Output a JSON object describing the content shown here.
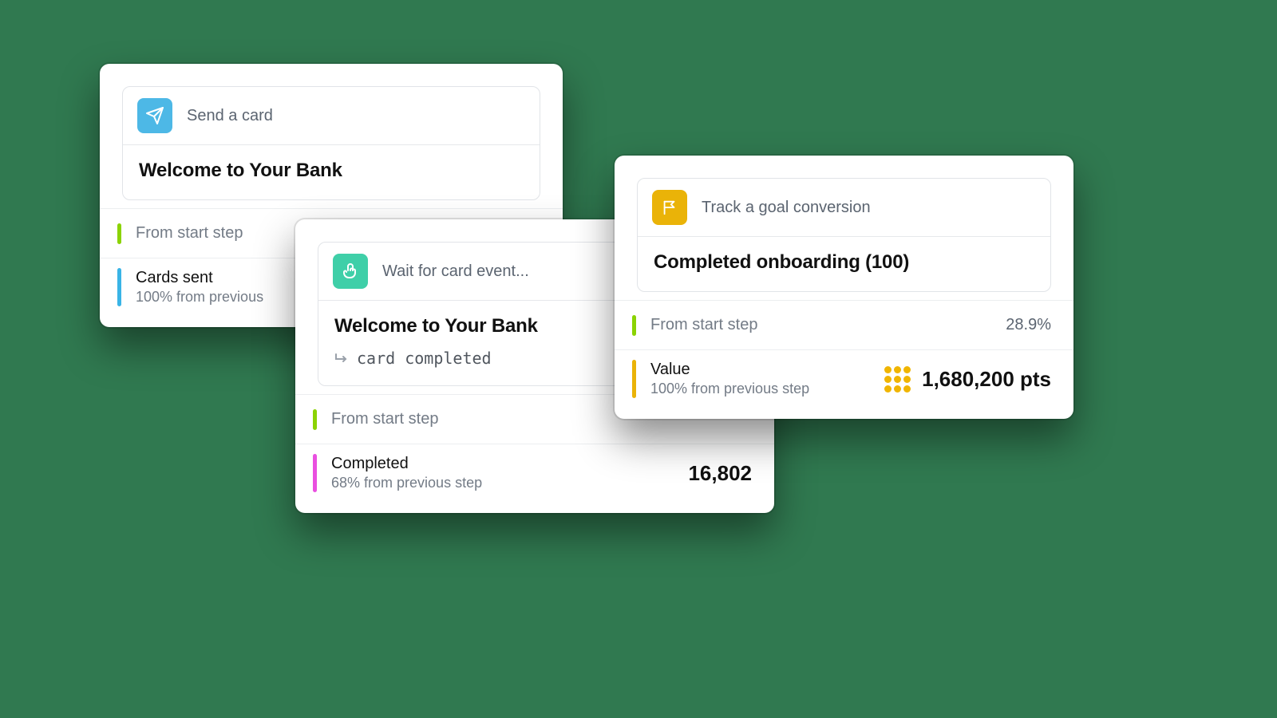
{
  "colors": {
    "background": "#307950",
    "icon_send": "#4db8e6",
    "icon_wait": "#3fcfa8",
    "icon_flag": "#eab308",
    "bar_green": "#8bd303",
    "bar_blue": "#39b4e6",
    "bar_pink": "#e94fe0",
    "bar_amber": "#eab308",
    "coin": "#f0b500"
  },
  "card1": {
    "header_label": "Send a card",
    "title": "Welcome to Your Bank",
    "stat1_label": "From start step",
    "stat2_label": "Cards sent",
    "stat2_sub": "100% from previous"
  },
  "card2": {
    "header_label": "Wait for card event...",
    "title": "Welcome to Your Bank",
    "subline": "card completed",
    "stat1_label": "From start step",
    "stat2_label": "Completed",
    "stat2_sub": "68% from previous step",
    "stat2_value": "16,802"
  },
  "card3": {
    "header_label": "Track a goal conversion",
    "title": "Completed onboarding (100)",
    "stat1_label": "From start step",
    "stat1_value": "28.9%",
    "stat2_label": "Value",
    "stat2_sub": "100% from previous step",
    "stat2_value": "1,680,200 pts"
  }
}
